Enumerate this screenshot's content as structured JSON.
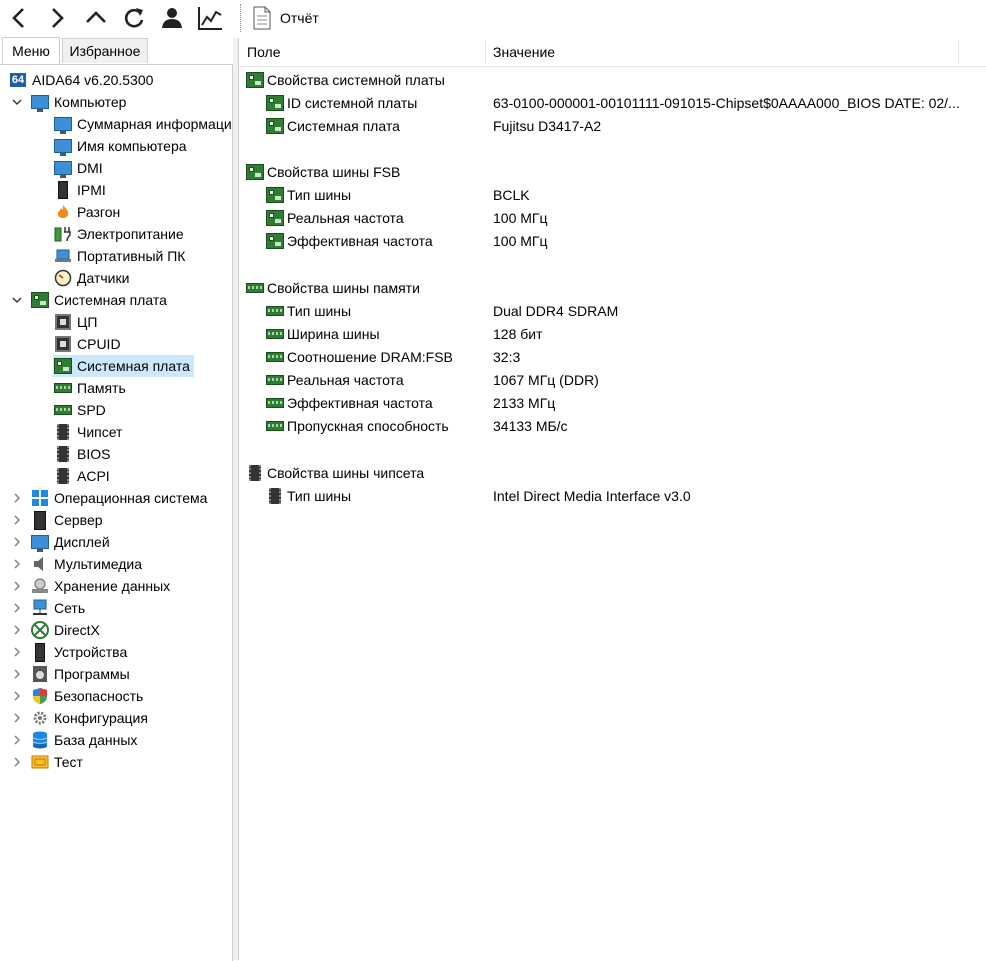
{
  "toolbar": {
    "report_label": "Отчёт"
  },
  "tabs": [
    {
      "label": "Меню"
    },
    {
      "label": "Избранное"
    }
  ],
  "tree": {
    "root": "AIDA64 v6.20.5300",
    "root_badge": "64",
    "computer": "Компьютер",
    "computer_children": [
      "Суммарная информация",
      "Имя компьютера",
      "DMI",
      "IPMI",
      "Разгон",
      "Электропитание",
      "Портативный ПК",
      "Датчики"
    ],
    "motherboard": "Системная плата",
    "motherboard_children": [
      "ЦП",
      "CPUID",
      "Системная плата",
      "Память",
      "SPD",
      "Чипсет",
      "BIOS",
      "ACPI"
    ],
    "others": [
      "Операционная система",
      "Сервер",
      "Дисплей",
      "Мультимедиа",
      "Хранение данных",
      "Сеть",
      "DirectX",
      "Устройства",
      "Программы",
      "Безопасность",
      "Конфигурация",
      "База данных",
      "Тест"
    ]
  },
  "table": {
    "col_field": "Поле",
    "col_value": "Значение",
    "groups": [
      {
        "title": "Свойства системной платы",
        "rows": [
          {
            "field": "ID системной платы",
            "value": "63-0100-000001-00101111-091015-Chipset$0AAAA000_BIOS DATE: 02/..."
          },
          {
            "field": "Системная плата",
            "value": "Fujitsu D3417-A2"
          }
        ]
      },
      {
        "title": "Свойства шины FSB",
        "rows": [
          {
            "field": "Тип шины",
            "value": "BCLK"
          },
          {
            "field": "Реальная частота",
            "value": "100 МГц"
          },
          {
            "field": "Эффективная частота",
            "value": "100 МГц"
          }
        ]
      },
      {
        "title": "Свойства шины памяти",
        "rows": [
          {
            "field": "Тип шины",
            "value": "Dual DDR4 SDRAM"
          },
          {
            "field": "Ширина шины",
            "value": "128 бит"
          },
          {
            "field": "Соотношение DRAM:FSB",
            "value": "32:3"
          },
          {
            "field": "Реальная частота",
            "value": "1067 МГц (DDR)"
          },
          {
            "field": "Эффективная частота",
            "value": "2133 МГц"
          },
          {
            "field": "Пропускная способность",
            "value": "34133 МБ/с"
          }
        ]
      },
      {
        "title": "Свойства шины чипсета",
        "rows": [
          {
            "field": "Тип шины",
            "value": "Intel Direct Media Interface v3.0"
          }
        ]
      }
    ]
  }
}
